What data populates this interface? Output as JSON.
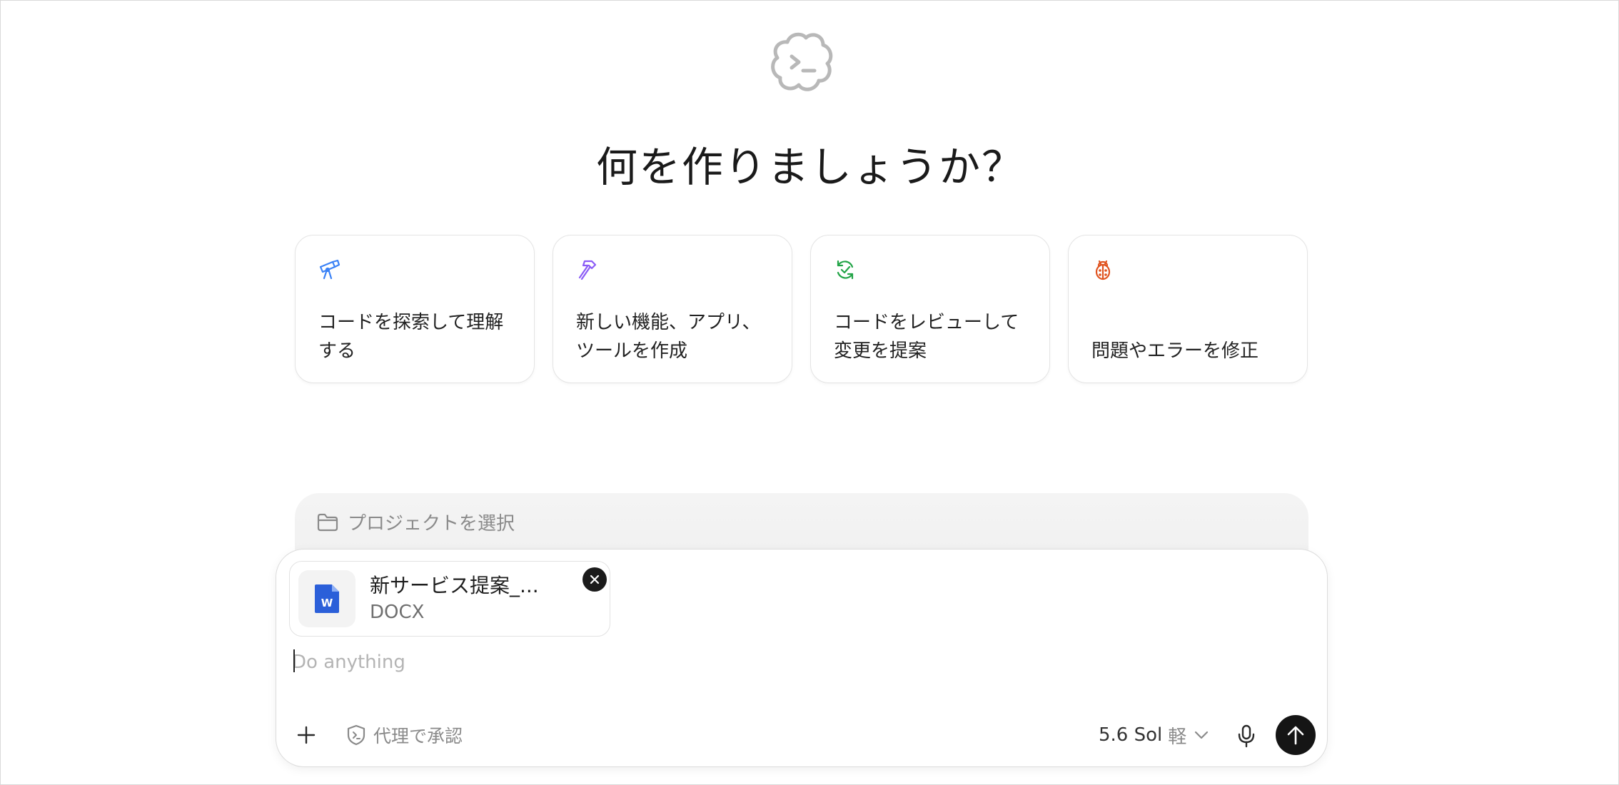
{
  "hero": {
    "logo_icon": "terminal-cloud-logo-icon",
    "title": "何を作りましょうか？"
  },
  "suggestions": [
    {
      "icon": "telescope-icon",
      "icon_color": "#3b82f6",
      "label": "コードを探索して理解する"
    },
    {
      "icon": "hammer-icon",
      "icon_color": "#8b5cf6",
      "label": "新しい機能、アプリ、ツールを作成"
    },
    {
      "icon": "refresh-check-icon",
      "icon_color": "#22a447",
      "label": "コードをレビューして変更を提案"
    },
    {
      "icon": "bug-icon",
      "icon_color": "#e0531f",
      "label": "問題やエラーを修正"
    }
  ],
  "project": {
    "icon": "folder-icon",
    "label": "プロジェクトを選択"
  },
  "composer": {
    "attachment": {
      "icon": "word-document-icon",
      "icon_color": "#2b5fd9",
      "name": "新サービス提案_...",
      "type": "DOCX"
    },
    "input_value": "",
    "placeholder": "Do anything",
    "toolbar": {
      "add_icon": "plus-icon",
      "approval_icon": "shield-terminal-icon",
      "approval_label": "代理で承認",
      "model_label": "5.6 Sol",
      "model_effort": "軽",
      "model_chevron_icon": "chevron-down-icon",
      "mic_icon": "microphone-icon",
      "send_icon": "arrow-up-icon"
    }
  }
}
